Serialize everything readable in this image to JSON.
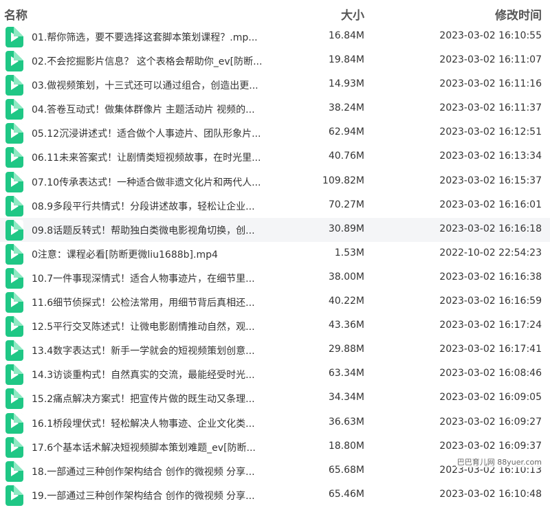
{
  "columns": {
    "name": "名称",
    "size": "大小",
    "modified": "修改时间"
  },
  "accent_color": "#1fc785",
  "file_icon": "video-file-icon",
  "files": [
    {
      "name": "01.帮你筛选，要不要选择这套脚本策划课程？.mp...",
      "size": "16.84M",
      "modified": "2023-03-02 16:10:55"
    },
    {
      "name": "02.不会挖掘影片信息？ 这个表格会帮助你_ev[防断...",
      "size": "19.84M",
      "modified": "2023-03-02 16:11:07"
    },
    {
      "name": "03.做视频策划，十三式还可以通过组合，创造出更...",
      "size": "14.93M",
      "modified": "2023-03-02 16:11:16"
    },
    {
      "name": "04.答卷互动式！做集体群像片 主题活动片 视频的...",
      "size": "38.24M",
      "modified": "2023-03-02 16:11:37"
    },
    {
      "name": "05.12沉浸讲述式！适合做个人事迹片、团队形象片...",
      "size": "62.94M",
      "modified": "2023-03-02 16:12:51"
    },
    {
      "name": "06.11未来答案式！让剧情类短视频故事，在时光里...",
      "size": "40.76M",
      "modified": "2023-03-02 16:13:34"
    },
    {
      "name": "07.10传承表达式！一种适合做非遗文化片和两代人...",
      "size": "109.82M",
      "modified": "2023-03-02 16:15:37"
    },
    {
      "name": "08.9多段平行共情式！分段讲述故事，轻松让企业...",
      "size": "70.27M",
      "modified": "2023-03-02 16:16:01"
    },
    {
      "name": "09.8话题反转式！帮助独白类微电影视角切换，创...",
      "size": "30.89M",
      "modified": "2023-03-02 16:16:18"
    },
    {
      "name": "0注意：课程必看[防断更微liu1688b].mp4",
      "size": "1.53M",
      "modified": "2022-10-02 22:54:23"
    },
    {
      "name": "10.7一件事现深情式！适合人物事迹片，在细节里...",
      "size": "38.00M",
      "modified": "2023-03-02 16:16:38"
    },
    {
      "name": "11.6细节侦探式！公检法常用，用细节背后真相还...",
      "size": "40.22M",
      "modified": "2023-03-02 16:16:59"
    },
    {
      "name": "12.5平行交叉陈述式！让微电影剧情推动自然，观...",
      "size": "43.36M",
      "modified": "2023-03-02 16:17:24"
    },
    {
      "name": "13.4数字表达式！新手一学就会的短视频策划创意...",
      "size": "29.88M",
      "modified": "2023-03-02 16:17:41"
    },
    {
      "name": "14.3访谈重构式！自然真实的交流，最能经受时光...",
      "size": "63.34M",
      "modified": "2023-03-02 16:08:46"
    },
    {
      "name": "15.2痛点解决方案式！把宣传片做的既生动又条理...",
      "size": "34.34M",
      "modified": "2023-03-02 16:09:05"
    },
    {
      "name": "16.1桥段埋伏式！轻松解决人物事迹、企业文化类...",
      "size": "36.63M",
      "modified": "2023-03-02 16:09:27"
    },
    {
      "name": "17.6个基本话术解决短视频脚本策划难题_ev[防断...",
      "size": "18.80M",
      "modified": "2023-03-02 16:09:37"
    },
    {
      "name": "18.一部通过三种创作架构结合 创作的微视频 分享...",
      "size": "65.68M",
      "modified": "2023-03-02 16:10:13"
    },
    {
      "name": "19.一部通过三种创作架构结合 创作的微视频 分享...",
      "size": "65.46M",
      "modified": "2023-03-02 16:10:48"
    }
  ],
  "watermark": "巴巴育儿网 88yuer.com"
}
